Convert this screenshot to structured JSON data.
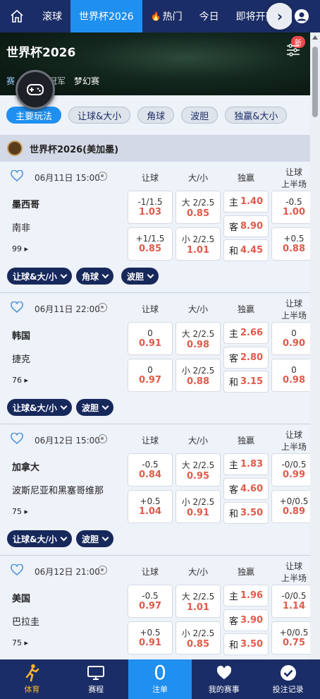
{
  "topnav": {
    "tabs": [
      {
        "label": "滚球"
      },
      {
        "label": "世界杯2026",
        "active": true
      },
      {
        "label": "热门"
      },
      {
        "label": "今日"
      },
      {
        "label": "即将开赛"
      }
    ]
  },
  "banner": {
    "title": "世界杯2026",
    "new_badge": "新",
    "tabs": [
      "赛",
      "冠军",
      "梦幻赛"
    ]
  },
  "filters": [
    "主要玩法",
    "让球&大小",
    "角球",
    "波胆",
    "独赢&大小"
  ],
  "league": {
    "name": "世界杯2026(美加墨)"
  },
  "column_headers": {
    "handicap": "让球",
    "over_under": "大/小",
    "moneyline": "独赢",
    "half_handicap_1": "让球",
    "half_handicap_2": "上半场"
  },
  "matches": [
    {
      "time": "06月11日 15:00",
      "home": "墨西哥",
      "away": "南非",
      "more": "99",
      "handicap": [
        {
          "line": "-1/1.5",
          "odds": "1.03"
        },
        {
          "line": "+1/1.5",
          "odds": "0.85"
        }
      ],
      "ou": [
        {
          "line": "大 2/2.5",
          "odds": "0.85"
        },
        {
          "line": "小 2/2.5",
          "odds": "1.01"
        }
      ],
      "moneyline": [
        {
          "k": "主",
          "odds": "1.40"
        },
        {
          "k": "客",
          "odds": "8.90"
        },
        {
          "k": "和",
          "odds": "4.45"
        }
      ],
      "half": [
        {
          "line": "-0.5",
          "odds": "1.00"
        },
        {
          "line": "+0.5",
          "odds": "0.88"
        }
      ],
      "pills": [
        "让球&大/小",
        "角球",
        "波胆"
      ]
    },
    {
      "time": "06月11日 22:00",
      "home": "韩国",
      "away": "捷克",
      "more": "76",
      "handicap": [
        {
          "line": "0",
          "odds": "0.91"
        },
        {
          "line": "0",
          "odds": "0.97"
        }
      ],
      "ou": [
        {
          "line": "大 2/2.5",
          "odds": "0.98"
        },
        {
          "line": "小 2/2.5",
          "odds": "0.88"
        }
      ],
      "moneyline": [
        {
          "k": "主",
          "odds": "2.66"
        },
        {
          "k": "客",
          "odds": "2.80"
        },
        {
          "k": "和",
          "odds": "3.15"
        }
      ],
      "half": [
        {
          "line": "0",
          "odds": "0.90"
        },
        {
          "line": "0",
          "odds": "0.98"
        }
      ],
      "pills": [
        "让球&大/小",
        "波胆"
      ]
    },
    {
      "time": "06月12日 15:00",
      "home": "加拿大",
      "away": "波斯尼亚和黑塞哥维那",
      "more": "75",
      "handicap": [
        {
          "line": "-0.5",
          "odds": "0.84"
        },
        {
          "line": "+0.5",
          "odds": "1.04"
        }
      ],
      "ou": [
        {
          "line": "大 2/2.5",
          "odds": "0.95"
        },
        {
          "line": "小 2/2.5",
          "odds": "0.91"
        }
      ],
      "moneyline": [
        {
          "k": "主",
          "odds": "1.83"
        },
        {
          "k": "客",
          "odds": "4.60"
        },
        {
          "k": "和",
          "odds": "3.50"
        }
      ],
      "half": [
        {
          "line": "-0/0.5",
          "odds": "0.99"
        },
        {
          "line": "+0/0.5",
          "odds": "0.89"
        }
      ],
      "pills": [
        "让球&大/小",
        "波胆"
      ]
    },
    {
      "time": "06月12日 21:00",
      "home": "美国",
      "away": "巴拉圭",
      "more": "75",
      "handicap": [
        {
          "line": "-0.5",
          "odds": "0.97"
        },
        {
          "line": "+0.5",
          "odds": "0.91"
        }
      ],
      "ou": [
        {
          "line": "大 2/2.5",
          "odds": "1.01"
        },
        {
          "line": "小 2/2.5",
          "odds": "0.85"
        }
      ],
      "moneyline": [
        {
          "k": "主",
          "odds": "1.96"
        },
        {
          "k": "客",
          "odds": "3.90"
        },
        {
          "k": "和",
          "odds": "3.50"
        }
      ],
      "half": [
        {
          "line": "-0/0.5",
          "odds": "1.14"
        },
        {
          "line": "+0/0.5",
          "odds": "0.75"
        }
      ],
      "pills": []
    }
  ],
  "bottom_nav": {
    "sports": "体育",
    "schedule": "赛程",
    "slip_count": "0",
    "slip": "注单",
    "my_events": "我的赛事",
    "bet_records": "投注记录"
  },
  "colors": {
    "nav": "#1b2d66",
    "accent": "#1f8ff0",
    "odds": "#e05a4a",
    "sports_active": "#f5b52e"
  }
}
